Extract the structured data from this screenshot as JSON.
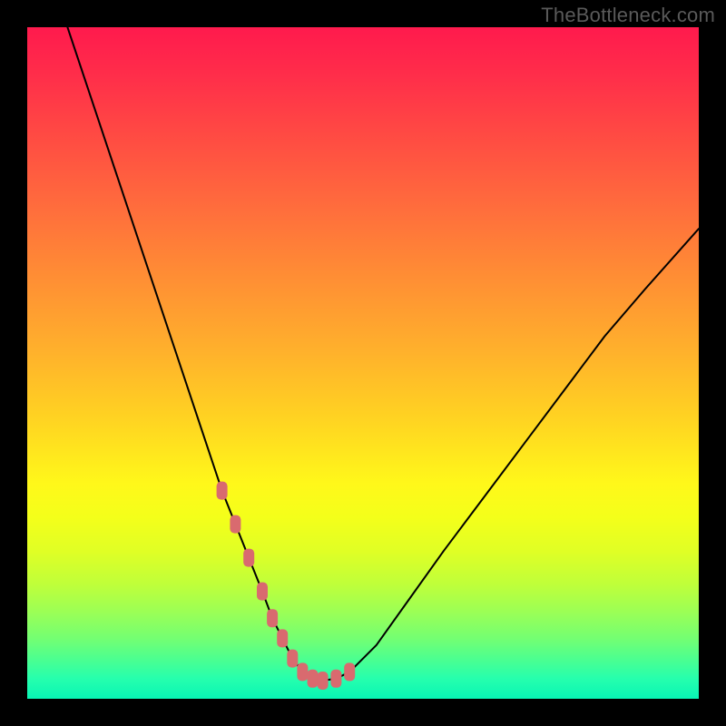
{
  "watermark": "TheBottleneck.com",
  "chart_data": {
    "type": "line",
    "title": "",
    "xlabel": "",
    "ylabel": "",
    "xlim": [
      0,
      100
    ],
    "ylim": [
      0,
      100
    ],
    "grid": false,
    "series": [
      {
        "name": "bottleneck-curve",
        "x": [
          6,
          10,
          14,
          18,
          22,
          26,
          29,
          31,
          33,
          35,
          36.5,
          38,
          39.5,
          41,
          42.5,
          44,
          46,
          48,
          52,
          57,
          62,
          68,
          74,
          80,
          86,
          92,
          100
        ],
        "values": [
          100,
          88,
          76,
          64,
          52,
          40,
          31,
          26,
          21,
          16,
          12,
          9,
          6,
          4,
          3,
          2.7,
          3,
          4,
          8,
          15,
          22,
          30,
          38,
          46,
          54,
          61,
          70
        ]
      }
    ],
    "markers": {
      "name": "highlight-band",
      "color": "#d96a6f",
      "x": [
        29,
        31,
        33,
        35,
        36.5,
        38,
        39.5,
        41,
        42.5,
        44,
        46,
        48
      ],
      "values": [
        31,
        26,
        21,
        16,
        12,
        9,
        6,
        4,
        3,
        2.7,
        3,
        4
      ]
    },
    "gradient_stops": [
      {
        "pos": 0,
        "color": "#ff1a4d"
      },
      {
        "pos": 7,
        "color": "#ff2d4a"
      },
      {
        "pos": 16,
        "color": "#ff4a43"
      },
      {
        "pos": 26,
        "color": "#ff6a3d"
      },
      {
        "pos": 36,
        "color": "#ff8a35"
      },
      {
        "pos": 48,
        "color": "#ffb02c"
      },
      {
        "pos": 58,
        "color": "#ffd222"
      },
      {
        "pos": 68,
        "color": "#fff81a"
      },
      {
        "pos": 73,
        "color": "#f4ff1a"
      },
      {
        "pos": 78,
        "color": "#e0ff25"
      },
      {
        "pos": 83,
        "color": "#bfff3a"
      },
      {
        "pos": 87,
        "color": "#9cff55"
      },
      {
        "pos": 91,
        "color": "#74ff72"
      },
      {
        "pos": 94,
        "color": "#4dff8f"
      },
      {
        "pos": 97,
        "color": "#26ffad"
      },
      {
        "pos": 100,
        "color": "#08f5b5"
      }
    ]
  },
  "colors": {
    "page_bg": "#000000",
    "curve": "#000000",
    "marker": "#d96a6f",
    "watermark": "#5a5a5a"
  }
}
